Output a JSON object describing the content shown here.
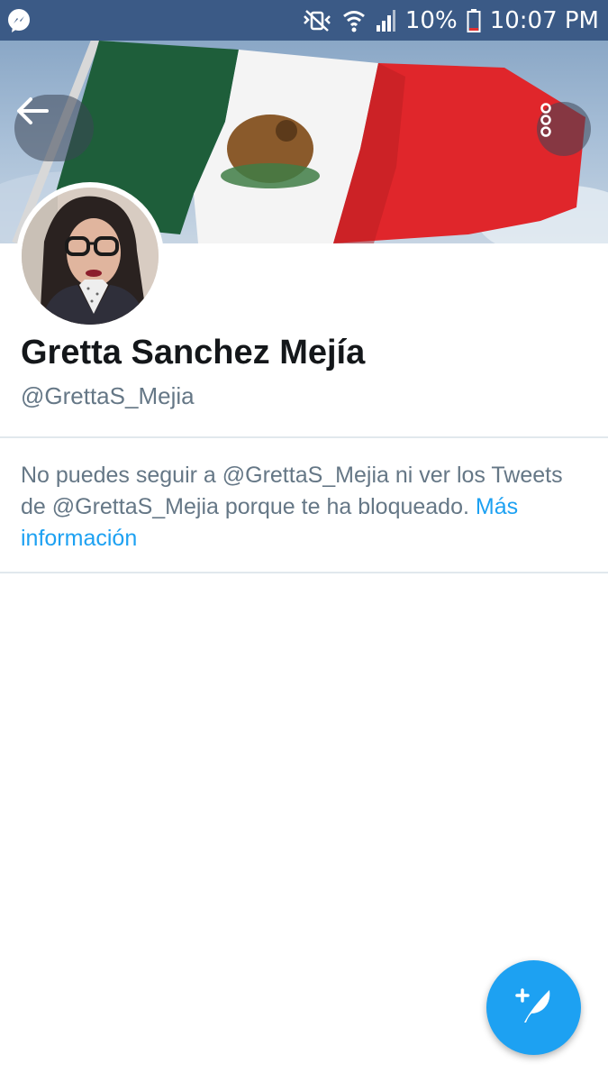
{
  "status_bar": {
    "battery": "10%",
    "time": "10:07 PM",
    "icons": [
      "messenger-icon",
      "mute-icon",
      "wifi-icon",
      "signal-icon",
      "battery-icon"
    ]
  },
  "header": {
    "back_icon": "arrow-left-icon",
    "more_icon": "more-vertical-icon",
    "banner_image": "mexican-flag-banner"
  },
  "profile": {
    "name": "Gretta Sanchez Mejía",
    "handle": "@GrettaS_Mejia"
  },
  "blocked_notice": {
    "text": "No puedes seguir a @GrettaS_Mejia ni ver los Tweets de @GrettaS_Mejia porque te ha bloqueado. ",
    "link": "Más información"
  },
  "compose_button": {
    "icon": "compose-tweet-icon"
  },
  "colors": {
    "status_bar": "#3b5a86",
    "accent": "#1da1f2",
    "secondary_text": "#657786",
    "primary_text": "#14171a",
    "divider": "#e1e8ed"
  }
}
